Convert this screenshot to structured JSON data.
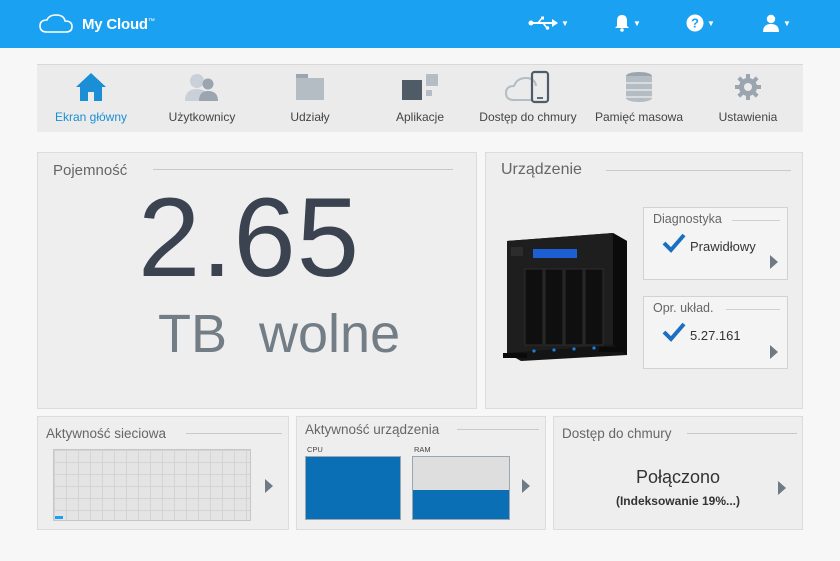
{
  "app": {
    "brand": "My Cloud",
    "trademark": "™"
  },
  "topbar": {
    "icons": [
      "usb-icon",
      "bell-icon",
      "help-icon",
      "user-icon"
    ]
  },
  "nav": {
    "items": [
      {
        "label": "Ekran główny",
        "icon": "home-icon",
        "active": true
      },
      {
        "label": "Użytkownicy",
        "icon": "users-icon"
      },
      {
        "label": "Udziały",
        "icon": "folder-icon"
      },
      {
        "label": "Aplikacje",
        "icon": "apps-icon"
      },
      {
        "label": "Dostęp do chmury",
        "icon": "cloud-device-icon"
      },
      {
        "label": "Pamięć masowa",
        "icon": "storage-icon"
      },
      {
        "label": "Ustawienia",
        "icon": "gear-icon"
      }
    ]
  },
  "capacity": {
    "title": "Pojemność",
    "value": "2.65",
    "unit": "TB",
    "suffix": "wolne"
  },
  "device": {
    "title": "Urządzenie",
    "diagnostics": {
      "title": "Diagnostyka",
      "status": "Prawidłowy"
    },
    "firmware": {
      "title": "Opr. układ.",
      "version": "5.27.161"
    }
  },
  "network": {
    "title": "Aktywność sieciowa"
  },
  "device_activity": {
    "title": "Aktywność urządzenia",
    "cpu_label": "CPU",
    "ram_label": "RAM",
    "cpu_percent": 100,
    "ram_percent": 47
  },
  "cloud": {
    "title": "Dostęp do chmury",
    "status": "Połączono",
    "detail": "(Indeksowanie 19%...)"
  },
  "colors": {
    "accent": "#1ba1f2",
    "bar": "#0a6fb5",
    "check": "#1a6fc0",
    "text_dark": "#3b4350"
  }
}
